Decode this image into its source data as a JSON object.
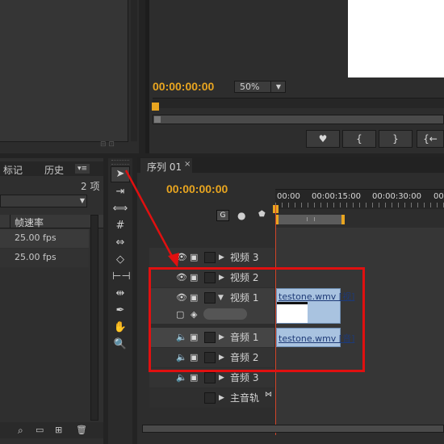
{
  "monitor": {
    "timecode": "00:00:00:00",
    "zoom": "50%",
    "buttons": [
      "♥",
      "{",
      "}",
      "{←"
    ]
  },
  "project_panel": {
    "tabs": [
      "标记",
      "历史"
    ],
    "item_count": "2 项",
    "column_header": "帧速率",
    "rows": [
      "25.00 fps",
      "25.00 fps"
    ]
  },
  "sequence": {
    "tab_label": "序列 01",
    "close": "×",
    "timecode": "00:00:00:00",
    "ruler": [
      "00:00",
      "00:00:15:00",
      "00:00:30:00",
      "00:"
    ]
  },
  "tracks": {
    "video3": "视频 3",
    "video2": "视频 2",
    "video1": "视频 1",
    "audio1": "音频 1",
    "audio2": "音频 2",
    "audio3": "音频 3",
    "master": "主音轨"
  },
  "clips": {
    "video_clip": "testone.wmv [视]",
    "audio_clip": "testone.wmv [音]"
  },
  "colors": {
    "accent": "#e8a520",
    "annotation": "#e01010",
    "clip": "#a9c3e0"
  }
}
